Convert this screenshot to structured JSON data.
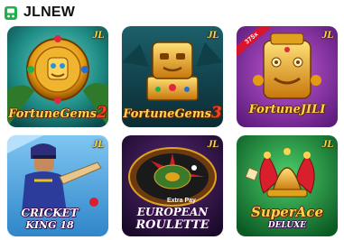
{
  "header": {
    "icon": "game-controller-icon",
    "title": "JLNEW"
  },
  "brand_badge": "JL",
  "colors": {
    "header_icon": "#22b04b",
    "gold": "#ffd34d"
  },
  "games": [
    {
      "id": "fortune-gems-2",
      "title": "FortuneGems",
      "suffix": "2"
    },
    {
      "id": "fortune-gems-3",
      "title": "FortuneGems",
      "suffix": "3"
    },
    {
      "id": "fortune-jili",
      "title": "FortuneJILI",
      "ribbon": "375x"
    },
    {
      "id": "cricket-king-18",
      "title_line1": "CRICKET",
      "title_line2": "KING 18"
    },
    {
      "id": "european-roulette",
      "tag": "Extra Pay",
      "title_line1": "EUROPEAN",
      "title_line2": "ROULETTE"
    },
    {
      "id": "super-ace-deluxe",
      "title": "SuperAce",
      "subtitle": "DELUXE"
    }
  ]
}
